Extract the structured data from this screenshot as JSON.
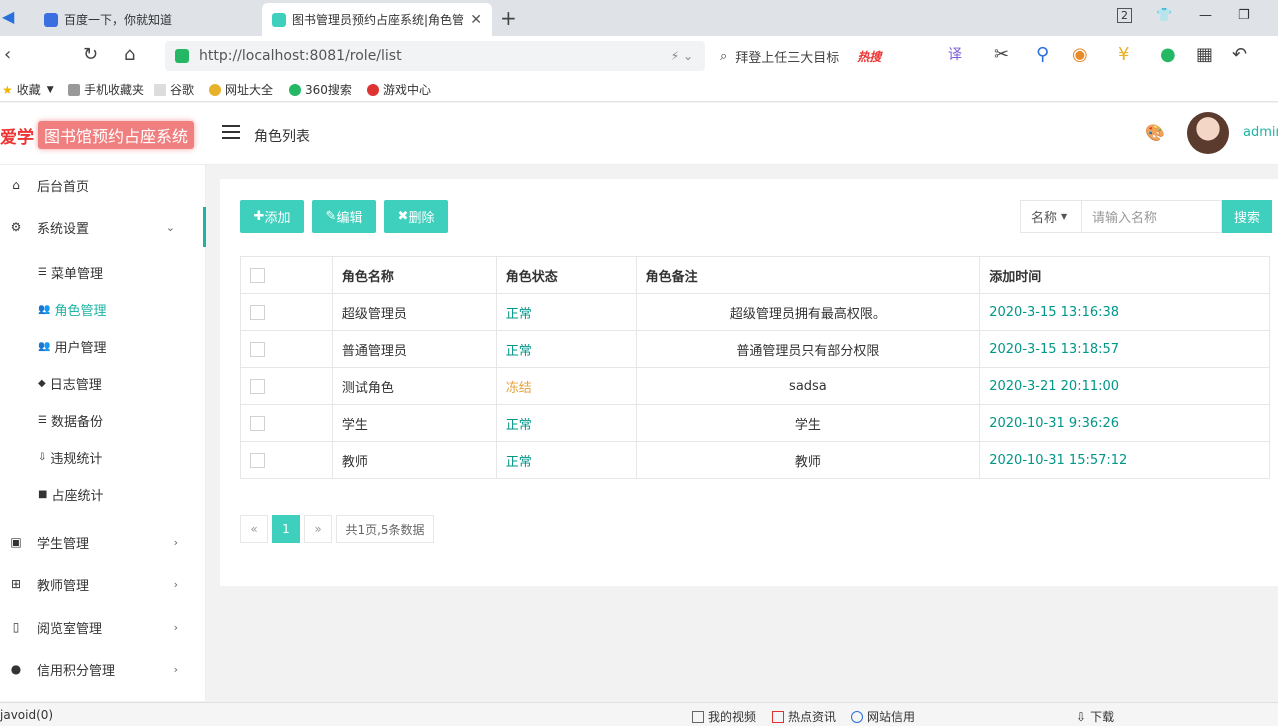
{
  "browser": {
    "tabs": [
      {
        "label": "百度一下，你就知道",
        "active": false
      },
      {
        "label": "图书管理员预约占座系统|角色管",
        "active": true
      }
    ],
    "url": "http://localhost:8081/role/list",
    "search_hint": "拜登上任三大目标",
    "hot_label": "热搜",
    "bookmarks": [
      "收藏",
      "手机收藏夹",
      "谷歌",
      "网址大全",
      "360搜索",
      "游戏中心"
    ],
    "window_badge": "2"
  },
  "app": {
    "logo_prefix": "爱学",
    "logo_title": "图书馆预约占座系统",
    "breadcrumb": "角色列表",
    "user": "admin"
  },
  "sidebar": {
    "home": "后台首页",
    "settings": "系统设置",
    "sub_items": [
      "菜单管理",
      "角色管理",
      "用户管理",
      "日志管理",
      "数据备份",
      "违规统计",
      "占座统计"
    ],
    "active_sub": "角色管理",
    "bottom_items": [
      "学生管理",
      "教师管理",
      "阅览室管理",
      "信用积分管理"
    ]
  },
  "toolbar": {
    "add": "添加",
    "edit": "编辑",
    "delete": "删除",
    "filter_field": "名称",
    "filter_placeholder": "请输入名称",
    "search": "搜索"
  },
  "table": {
    "headers": [
      "角色名称",
      "角色状态",
      "角色备注",
      "添加时间"
    ],
    "rows": [
      {
        "name": "超级管理员",
        "status": "正常",
        "remark": "超级管理员拥有最高权限。",
        "time": "2020-3-15 13:16:38"
      },
      {
        "name": "普通管理员",
        "status": "正常",
        "remark": "普通管理员只有部分权限",
        "time": "2020-3-15 13:18:57"
      },
      {
        "name": "测试角色",
        "status": "冻结",
        "remark": "sadsa",
        "time": "2020-3-21 20:11:00"
      },
      {
        "name": "学生",
        "status": "正常",
        "remark": "学生",
        "time": "2020-10-31 9:36:26"
      },
      {
        "name": "教师",
        "status": "正常",
        "remark": "教师",
        "time": "2020-10-31 15:57:12"
      }
    ]
  },
  "pager": {
    "prev": "«",
    "current": "1",
    "next": "»",
    "summary": "共1页,5条数据"
  },
  "statusbar": {
    "left": "javoid(0)",
    "items": [
      "我的视频",
      "热点资讯",
      "网站信用",
      "下载"
    ]
  },
  "colors": {
    "accent": "#3ecfbd",
    "ok": "#009688",
    "frozen": "#e8a23a"
  }
}
